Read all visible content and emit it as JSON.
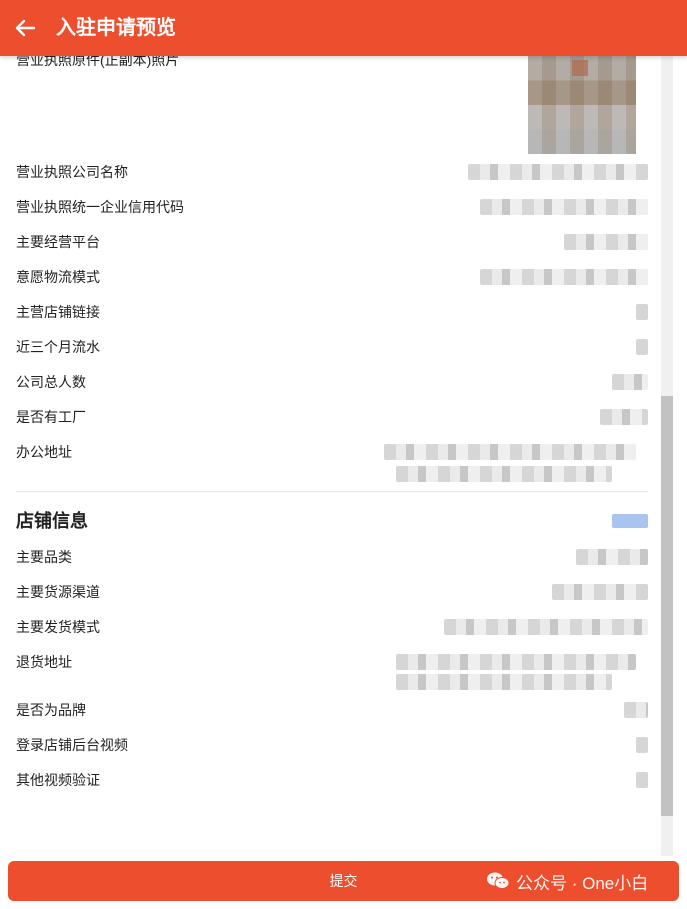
{
  "header": {
    "title": "入驻申请预览",
    "back_icon": "arrow-left-icon"
  },
  "business_license": {
    "photo_label": "营业执照原件(正副本)照片",
    "rows": [
      {
        "label": "营业执照公司名称"
      },
      {
        "label": "营业执照统一企业信用代码"
      },
      {
        "label": "主要经营平台"
      },
      {
        "label": "意愿物流模式"
      },
      {
        "label": "主营店铺链接"
      },
      {
        "label": "近三个月流水"
      },
      {
        "label": "公司总人数"
      },
      {
        "label": "是否有工厂"
      },
      {
        "label": "办公地址"
      }
    ]
  },
  "store_info": {
    "title": "店铺信息",
    "rows": [
      {
        "label": "主要品类"
      },
      {
        "label": "主要货源渠道"
      },
      {
        "label": "主要发货模式"
      },
      {
        "label": "退货地址"
      },
      {
        "label": "是否为品牌"
      },
      {
        "label": "登录店铺后台视频"
      },
      {
        "label": "其他视频验证"
      }
    ]
  },
  "submit_label": "提交",
  "watermark": {
    "text": "公众号 · One小白",
    "icon": "wechat-icon"
  },
  "colors": {
    "accent": "#ec4e2e",
    "text": "#222222",
    "divider": "#e6e6e6"
  }
}
